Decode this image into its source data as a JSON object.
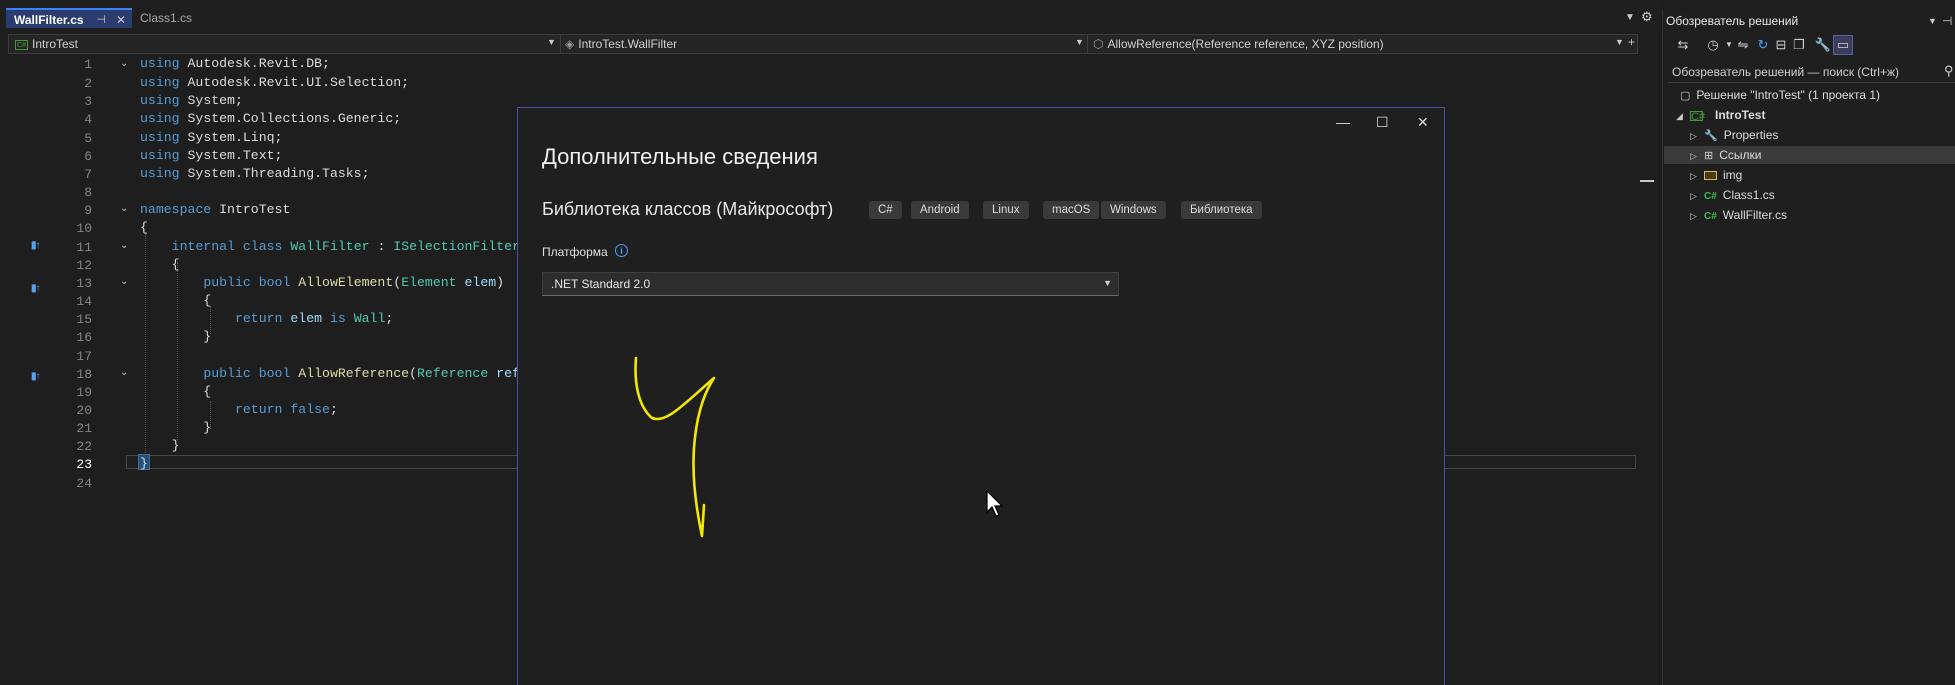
{
  "tabs": [
    {
      "label": "WallFilter.cs",
      "active": true
    },
    {
      "label": "Class1.cs",
      "active": false
    }
  ],
  "navbar": {
    "project": "IntroTest",
    "type": "IntroTest.WallFilter",
    "member": "AllowReference(Reference reference, XYZ position)"
  },
  "editor": {
    "line_numbers": [
      "1",
      "2",
      "3",
      "4",
      "5",
      "6",
      "7",
      "8",
      "9",
      "10",
      "11",
      "12",
      "13",
      "14",
      "15",
      "16",
      "17",
      "18",
      "19",
      "20",
      "21",
      "22",
      "23",
      "24"
    ],
    "current_line": "23"
  },
  "solution_explorer": {
    "title": "Обозреватель решений",
    "search_placeholder": "Обозреватель решений — поиск (Ctrl+ж)",
    "tree": [
      {
        "label": "Решение \"IntroTest\"  (1 проекта 1)",
        "icon": "solution-icon"
      },
      {
        "label": "IntroTest",
        "icon": "csharp-project-icon"
      },
      {
        "label": "Properties",
        "icon": "wrench-icon"
      },
      {
        "label": "Ссылки",
        "icon": "references-icon"
      },
      {
        "label": "img",
        "icon": "folder-icon"
      },
      {
        "label": "Class1.cs",
        "icon": "csharp-file-icon"
      },
      {
        "label": "WallFilter.cs",
        "icon": "csharp-file-icon"
      }
    ]
  },
  "dialog": {
    "title": "Дополнительные сведения",
    "template_name": "Библиотека классов (Майкрософт)",
    "tags": [
      "C#",
      "Android",
      "Linux",
      "macOS",
      "Windows",
      "Библиотека"
    ],
    "platform_label": "Платформа",
    "platform_value": ".NET Standard 2.0"
  },
  "colors": {
    "accent": "#3b82f6",
    "dialog_border": "#4b4fa8",
    "annotation": "#f5e800"
  }
}
